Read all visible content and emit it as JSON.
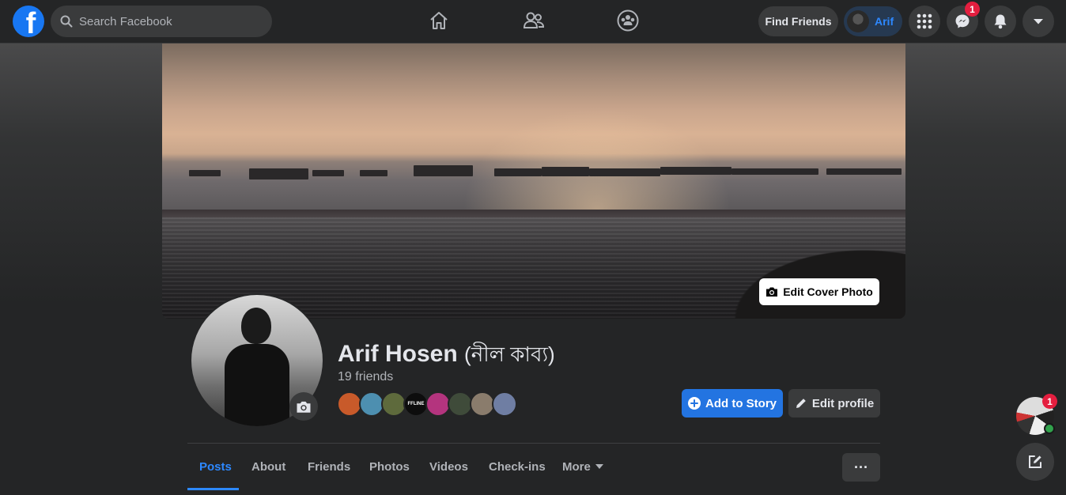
{
  "nav": {
    "logo_letter": "f",
    "search_placeholder": "Search Facebook",
    "center_icons": [
      "home-icon",
      "friends-icon",
      "groups-icon"
    ],
    "find_friends_label": "Find Friends",
    "profile_name": "Arif",
    "messenger_badge": "1",
    "icons": [
      "menu-grid-icon",
      "messenger-icon",
      "notifications-icon",
      "account-caret-icon"
    ]
  },
  "cover": {
    "edit_label": "Edit Cover Photo"
  },
  "profile": {
    "name": "Arif Hosen",
    "alt_name": "(নীল কাব্য)",
    "friends_count": "19 friends",
    "friend_avatar_colors": [
      "#c85a2a",
      "#4d8fb0",
      "#5e6a3c",
      "#0d0d0d",
      "#b4347e",
      "#3f4b3a",
      "#8a7c6c",
      "#6f7ea3"
    ],
    "friend_avatar_label": "FFLINE",
    "add_story_label": "Add to Story",
    "edit_profile_label": "Edit profile"
  },
  "tabs": [
    {
      "label": "Posts",
      "active": true
    },
    {
      "label": "About"
    },
    {
      "label": "Friends"
    },
    {
      "label": "Photos"
    },
    {
      "label": "Videos"
    },
    {
      "label": "Check-ins"
    },
    {
      "label": "More"
    }
  ],
  "more_button_label": "···",
  "chat": {
    "badge": "1"
  },
  "colors": {
    "accent": "#2d88ff",
    "primary_button": "#2374e1",
    "badge": "#e41e3f",
    "online": "#31a24c"
  }
}
